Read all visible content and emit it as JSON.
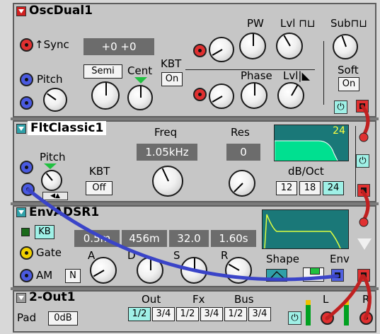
{
  "colors": {
    "module_bg": "#c6c6c6",
    "display_bg": "#6c6c6c",
    "jack_red": "#e03030",
    "jack_blue": "#4a5ae0",
    "cable_red": "#d02020",
    "cable_blue": "#3a44c8",
    "button_on": "#9ff0e6",
    "graph_green": "#00e090",
    "graph_bg": "#1a7878"
  },
  "osc": {
    "title": "OscDual1",
    "sync": "Sync",
    "sync_values": "+0  +0",
    "semi": "Semi",
    "cent": "Cent",
    "kbt": "KBT",
    "kbt_value": "On",
    "pitch": "Pitch",
    "pw": "PW",
    "lvl_sq": "Lvl",
    "sub": "Sub",
    "phase": "Phase",
    "lvl_saw": "Lvl",
    "soft": "Soft",
    "soft_value": "On",
    "power": "⏻"
  },
  "flt": {
    "title": "FltClassic1",
    "pitch": "Pitch",
    "freq": "Freq",
    "freq_value": "1.05kHz",
    "res": "Res",
    "res_value": "0",
    "kbt": "KBT",
    "kbt_value": "Off",
    "db_oct": "dB/Oct",
    "slope_value": "24",
    "slopes": [
      "12",
      "18",
      "24"
    ],
    "power": "⏻"
  },
  "env": {
    "title": "EnvADSR1",
    "kb": "KB",
    "values": [
      "0.5m",
      "456m",
      "32.0",
      "1.60s"
    ],
    "gate": "Gate",
    "a": "A",
    "d": "D",
    "s": "S",
    "r": "R",
    "am": "AM",
    "am_value": "N",
    "shape": "Shape",
    "env": "Env"
  },
  "out": {
    "title": "2-Out1",
    "pad": "Pad",
    "pad_value": "0dB",
    "out": "Out",
    "fx": "Fx",
    "bus": "Bus",
    "routes": [
      "1/2",
      "3/4",
      "1/2",
      "3/4",
      "1/2",
      "3/4"
    ],
    "l": "L",
    "r": "R",
    "power": "⏻"
  }
}
